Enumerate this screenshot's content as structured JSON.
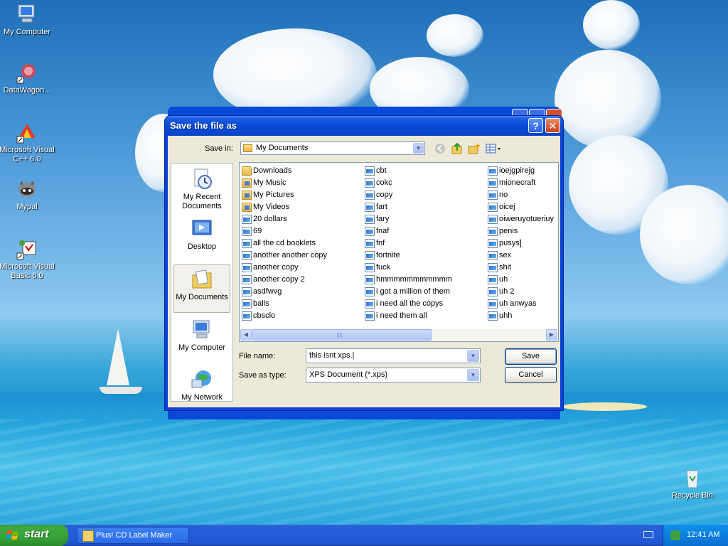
{
  "desktop": {
    "icons": [
      {
        "label": "My Computer"
      },
      {
        "label": "DataWagon..."
      },
      {
        "label": "Microsoft Visual C++ 6.0"
      },
      {
        "label": "Mypal"
      },
      {
        "label": "Microsoft Visual Basic 6.0"
      },
      {
        "label": "Recycle Bin"
      }
    ]
  },
  "dialog": {
    "title": "Save the file as",
    "help_label": "?",
    "close_label": "✕",
    "save_in_label": "Save in:",
    "save_in_value": "My Documents",
    "places": [
      {
        "label": "My Recent Documents"
      },
      {
        "label": "Desktop"
      },
      {
        "label": "My Documents"
      },
      {
        "label": "My Computer"
      },
      {
        "label": "My Network"
      }
    ],
    "file_columns": [
      [
        {
          "name": "Downloads",
          "type": "folder"
        },
        {
          "name": "My Music",
          "type": "special"
        },
        {
          "name": "My Pictures",
          "type": "special"
        },
        {
          "name": "My Videos",
          "type": "special"
        },
        {
          "name": "20 dollars",
          "type": "doc"
        },
        {
          "name": "69",
          "type": "doc"
        },
        {
          "name": "all the cd booklets",
          "type": "doc"
        },
        {
          "name": "another another copy",
          "type": "doc"
        },
        {
          "name": "another copy",
          "type": "doc"
        },
        {
          "name": "another copy 2",
          "type": "doc"
        },
        {
          "name": "asdfwvg",
          "type": "doc"
        },
        {
          "name": "balls",
          "type": "doc"
        },
        {
          "name": "cbsclo",
          "type": "doc"
        }
      ],
      [
        {
          "name": "cbt",
          "type": "doc"
        },
        {
          "name": "cokc",
          "type": "doc"
        },
        {
          "name": "copy",
          "type": "doc"
        },
        {
          "name": "fart",
          "type": "doc"
        },
        {
          "name": "fary",
          "type": "doc"
        },
        {
          "name": "fnaf",
          "type": "doc"
        },
        {
          "name": "fnf",
          "type": "doc"
        },
        {
          "name": "fortnite",
          "type": "doc"
        },
        {
          "name": "fuck",
          "type": "doc"
        },
        {
          "name": "hmmmmmmmmmmm",
          "type": "doc"
        },
        {
          "name": "i got a million of them",
          "type": "doc"
        },
        {
          "name": "i need all the copys",
          "type": "doc"
        },
        {
          "name": "i need them all",
          "type": "doc"
        }
      ],
      [
        {
          "name": "ioejgpirejg",
          "type": "doc"
        },
        {
          "name": "mionecraft",
          "type": "doc"
        },
        {
          "name": "no",
          "type": "doc"
        },
        {
          "name": "oicej",
          "type": "doc"
        },
        {
          "name": "oiweruyotueriuy",
          "type": "doc"
        },
        {
          "name": "penis",
          "type": "doc"
        },
        {
          "name": "pusys]",
          "type": "doc"
        },
        {
          "name": "sex",
          "type": "doc"
        },
        {
          "name": "shit",
          "type": "doc"
        },
        {
          "name": "uh",
          "type": "doc"
        },
        {
          "name": "uh 2",
          "type": "doc"
        },
        {
          "name": "uh anwyas",
          "type": "doc"
        },
        {
          "name": "uhh",
          "type": "doc"
        }
      ]
    ],
    "file_name_label": "File name:",
    "file_name_value": "this isnt xps.|",
    "save_as_type_label": "Save as type:",
    "save_as_type_value": "XPS Document (*.xps)",
    "save_button": "Save",
    "cancel_button": "Cancel"
  },
  "taskbar": {
    "start_label": "start",
    "task_label": "Plus! CD Label Maker",
    "clock": "12:41 AM"
  }
}
